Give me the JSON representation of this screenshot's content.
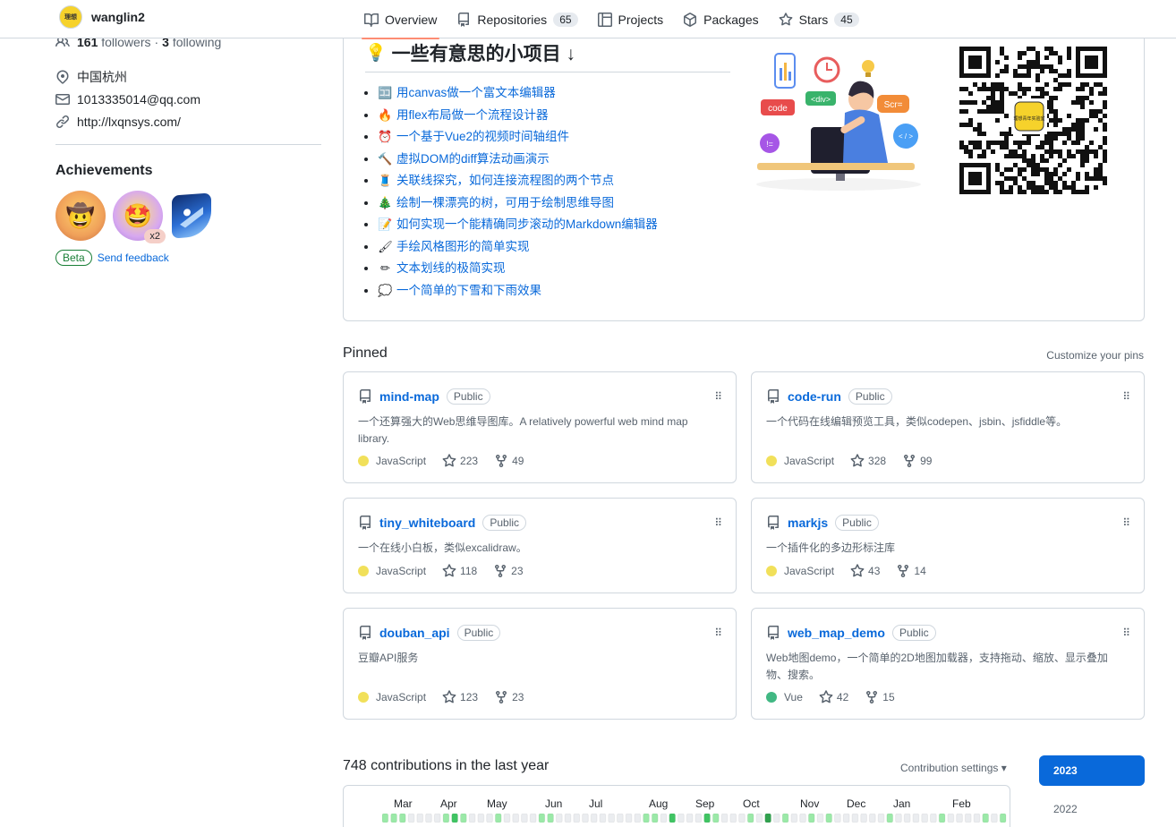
{
  "topbar": {
    "username": "wanglin2",
    "tabs": [
      {
        "label": "Overview",
        "count": "",
        "active": true
      },
      {
        "label": "Repositories",
        "count": "65"
      },
      {
        "label": "Projects",
        "count": ""
      },
      {
        "label": "Packages",
        "count": ""
      },
      {
        "label": "Stars",
        "count": "45"
      }
    ]
  },
  "sidebar": {
    "followers_count": "161",
    "followers_label": "followers",
    "separator": "·",
    "following_count": "3",
    "following_label": "following",
    "location": "中国杭州",
    "email": "1013335014@qq.com",
    "website": "http://lxqnsys.com/",
    "achievements_title": "Achievements",
    "achievement_multiplier": "x2",
    "beta_label": "Beta",
    "feedback_label": "Send feedback"
  },
  "readme": {
    "title": "一些有意思的小项目 ↓",
    "items": [
      {
        "icon": "🈁",
        "text": "用canvas做一个富文本编辑器"
      },
      {
        "icon": "🔥",
        "text": "用flex布局做一个流程设计器"
      },
      {
        "icon": "⏰",
        "text": "一个基于Vue2的视频时间轴组件"
      },
      {
        "icon": "🔨",
        "text": "虚拟DOM的diff算法动画演示"
      },
      {
        "icon": "🧵",
        "text": "关联线探究，如何连接流程图的两个节点"
      },
      {
        "icon": "🎄",
        "text": "绘制一棵漂亮的树，可用于绘制思维导图"
      },
      {
        "icon": "📝",
        "text": "如何实现一个能精确同步滚动的Markdown编辑器"
      },
      {
        "icon": "🖌",
        "text": "手绘风格图形的简单实现"
      },
      {
        "icon": "✏",
        "text": "文本划线的极简实现"
      },
      {
        "icon": "💭",
        "text": "一个简单的下雪和下雨效果"
      }
    ],
    "illustration_labels": {
      "code": "code",
      "div": "<div>",
      "scr": "Scr=",
      "tag": "< / >",
      "neq": "!="
    },
    "qr_logo_text": "理想青年实验室"
  },
  "pinned": {
    "heading": "Pinned",
    "customize_label": "Customize your pins",
    "repos": [
      {
        "name": "mind-map",
        "visibility": "Public",
        "desc": "一个还算强大的Web思维导图库。A relatively powerful web mind map library.",
        "lang": "JavaScript",
        "lang_color": "#f1e05a",
        "stars": "223",
        "forks": "49"
      },
      {
        "name": "code-run",
        "visibility": "Public",
        "desc": "一个代码在线编辑预览工具，类似codepen、jsbin、jsfiddle等。",
        "lang": "JavaScript",
        "lang_color": "#f1e05a",
        "stars": "328",
        "forks": "99"
      },
      {
        "name": "tiny_whiteboard",
        "visibility": "Public",
        "desc": "一个在线小白板，类似excalidraw。",
        "lang": "JavaScript",
        "lang_color": "#f1e05a",
        "stars": "118",
        "forks": "23"
      },
      {
        "name": "markjs",
        "visibility": "Public",
        "desc": "一个插件化的多边形标注库",
        "lang": "JavaScript",
        "lang_color": "#f1e05a",
        "stars": "43",
        "forks": "14"
      },
      {
        "name": "douban_api",
        "visibility": "Public",
        "desc": "豆瓣API服务",
        "lang": "JavaScript",
        "lang_color": "#f1e05a",
        "stars": "123",
        "forks": "23"
      },
      {
        "name": "web_map_demo",
        "visibility": "Public",
        "desc": "Web地图demo，一个简单的2D地图加载器，支持拖动、缩放、显示叠加物、搜索。",
        "lang": "Vue",
        "lang_color": "#41b883",
        "stars": "42",
        "forks": "15"
      }
    ]
  },
  "contributions": {
    "heading": "748 contributions in the last year",
    "settings_label": "Contribution settings ▾",
    "years": [
      "2023",
      "2022"
    ],
    "months": [
      "Mar",
      "Apr",
      "May",
      "Jun",
      "Jul",
      "Aug",
      "Sep",
      "Oct",
      "Nov",
      "Dec",
      "Jan",
      "Feb"
    ],
    "week_levels": [
      1,
      1,
      1,
      0,
      0,
      0,
      0,
      1,
      2,
      1,
      0,
      0,
      0,
      1,
      0,
      0,
      0,
      0,
      1,
      1,
      0,
      0,
      0,
      0,
      0,
      0,
      0,
      0,
      0,
      0,
      1,
      1,
      0,
      2,
      0,
      0,
      0,
      2,
      1,
      0,
      0,
      0,
      1,
      0,
      3,
      0,
      1,
      0,
      0,
      1,
      0,
      1,
      0,
      0,
      0,
      0,
      0,
      0,
      1,
      0,
      0,
      0,
      0,
      0,
      1,
      0,
      0,
      0,
      0,
      1,
      0,
      1
    ],
    "level_colors": [
      "#ebedf0",
      "#9be9a8",
      "#40c463",
      "#30a14e"
    ]
  }
}
